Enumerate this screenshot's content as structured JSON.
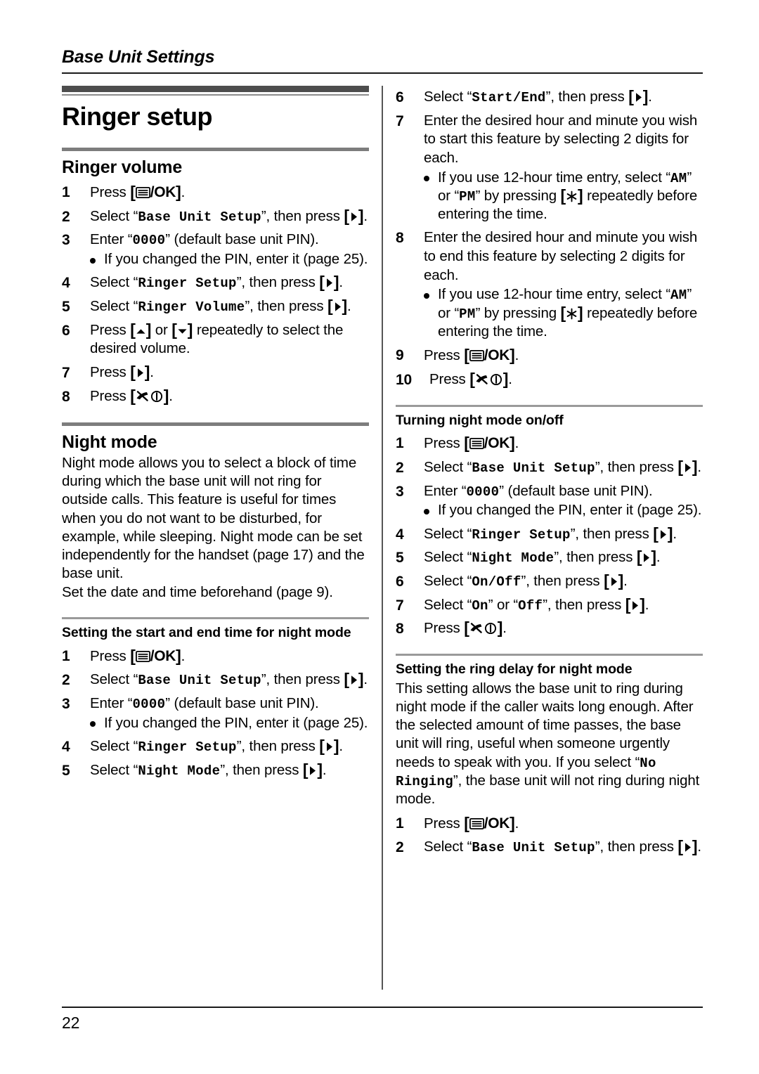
{
  "running_head": "Base Unit Settings",
  "page_number": "22",
  "chapter_title": "Ringer setup",
  "keys": {
    "menu_ok": "[▤/OK]",
    "right": "[▶]",
    "up": "[▲]",
    "down": "[▼]",
    "star": "[✳]",
    "power_off": "[✗ⓘ]"
  },
  "left_column": {
    "section_ringer_volume": {
      "heading": "Ringer volume",
      "steps": [
        {
          "num": "1",
          "parts": [
            {
              "t": "text",
              "v": "Press "
            },
            {
              "t": "key",
              "v": "menu_ok"
            },
            {
              "t": "text",
              "v": "."
            }
          ]
        },
        {
          "num": "2",
          "parts": [
            {
              "t": "text",
              "v": "Select “"
            },
            {
              "t": "mono",
              "v": "Base Unit Setup"
            },
            {
              "t": "text",
              "v": "”, then press "
            },
            {
              "t": "key",
              "v": "right"
            },
            {
              "t": "text",
              "v": "."
            }
          ]
        },
        {
          "num": "3",
          "parts": [
            {
              "t": "text",
              "v": "Enter “"
            },
            {
              "t": "mono",
              "v": "0000"
            },
            {
              "t": "text",
              "v": "” (default base unit PIN)."
            }
          ],
          "bullets": [
            "If you changed the PIN, enter it (page 25)."
          ]
        },
        {
          "num": "4",
          "parts": [
            {
              "t": "text",
              "v": "Select “"
            },
            {
              "t": "mono",
              "v": "Ringer Setup"
            },
            {
              "t": "text",
              "v": "”, then press "
            },
            {
              "t": "key",
              "v": "right"
            },
            {
              "t": "text",
              "v": "."
            }
          ]
        },
        {
          "num": "5",
          "parts": [
            {
              "t": "text",
              "v": "Select “"
            },
            {
              "t": "mono",
              "v": "Ringer Volume"
            },
            {
              "t": "text",
              "v": "”, then press "
            },
            {
              "t": "key",
              "v": "right"
            },
            {
              "t": "text",
              "v": "."
            }
          ]
        },
        {
          "num": "6",
          "parts": [
            {
              "t": "text",
              "v": "Press "
            },
            {
              "t": "key",
              "v": "up"
            },
            {
              "t": "text",
              "v": " or "
            },
            {
              "t": "key",
              "v": "down"
            },
            {
              "t": "text",
              "v": " repeatedly to select the desired volume."
            }
          ]
        },
        {
          "num": "7",
          "parts": [
            {
              "t": "text",
              "v": "Press "
            },
            {
              "t": "key",
              "v": "right"
            },
            {
              "t": "text",
              "v": "."
            }
          ]
        },
        {
          "num": "8",
          "parts": [
            {
              "t": "text",
              "v": "Press "
            },
            {
              "t": "key",
              "v": "power_off"
            },
            {
              "t": "text",
              "v": "."
            }
          ]
        }
      ]
    },
    "section_night_mode": {
      "heading": "Night mode",
      "paragraphs": [
        "Night mode allows you to select a block of time during which the base unit will not ring for outside calls. This feature is useful for times when you do not want to be disturbed, for example, while sleeping. Night mode can be set independently for the handset (page 17) and the base unit.",
        "Set the date and time beforehand (page 9)."
      ],
      "subsection_start_end": {
        "heading": "Setting the start and end time for night mode",
        "steps": [
          {
            "num": "1",
            "parts": [
              {
                "t": "text",
                "v": "Press "
              },
              {
                "t": "key",
                "v": "menu_ok"
              },
              {
                "t": "text",
                "v": "."
              }
            ]
          },
          {
            "num": "2",
            "parts": [
              {
                "t": "text",
                "v": "Select “"
              },
              {
                "t": "mono",
                "v": "Base Unit Setup"
              },
              {
                "t": "text",
                "v": "”, then press "
              },
              {
                "t": "key",
                "v": "right"
              },
              {
                "t": "text",
                "v": "."
              }
            ]
          },
          {
            "num": "3",
            "parts": [
              {
                "t": "text",
                "v": "Enter “"
              },
              {
                "t": "mono",
                "v": "0000"
              },
              {
                "t": "text",
                "v": "” (default base unit PIN)."
              }
            ],
            "bullets": [
              "If you changed the PIN, enter it (page 25)."
            ]
          },
          {
            "num": "4",
            "parts": [
              {
                "t": "text",
                "v": "Select “"
              },
              {
                "t": "mono",
                "v": "Ringer Setup"
              },
              {
                "t": "text",
                "v": "”, then press "
              },
              {
                "t": "key",
                "v": "right"
              },
              {
                "t": "text",
                "v": "."
              }
            ]
          },
          {
            "num": "5",
            "parts": [
              {
                "t": "text",
                "v": "Select “"
              },
              {
                "t": "mono",
                "v": "Night Mode"
              },
              {
                "t": "text",
                "v": "”, then press "
              },
              {
                "t": "key",
                "v": "right"
              },
              {
                "t": "text",
                "v": "."
              }
            ]
          }
        ]
      }
    }
  },
  "right_column": {
    "continued_start_end_steps": [
      {
        "num": "6",
        "parts": [
          {
            "t": "text",
            "v": "Select “"
          },
          {
            "t": "mono",
            "v": "Start/End"
          },
          {
            "t": "text",
            "v": "”, then press "
          },
          {
            "t": "key",
            "v": "right"
          },
          {
            "t": "text",
            "v": "."
          }
        ]
      },
      {
        "num": "7",
        "parts": [
          {
            "t": "text",
            "v": "Enter the desired hour and minute you wish to start this feature by selecting 2 digits for each."
          }
        ],
        "bullet_parts": [
          [
            {
              "t": "text",
              "v": "If you use 12-hour time entry, select “"
            },
            {
              "t": "mono",
              "v": "AM"
            },
            {
              "t": "text",
              "v": "” or “"
            },
            {
              "t": "mono",
              "v": "PM"
            },
            {
              "t": "text",
              "v": "” by pressing "
            },
            {
              "t": "key",
              "v": "star"
            },
            {
              "t": "text",
              "v": " repeatedly before entering the time."
            }
          ]
        ]
      },
      {
        "num": "8",
        "parts": [
          {
            "t": "text",
            "v": "Enter the desired hour and minute you wish to end this feature by selecting 2 digits for each."
          }
        ],
        "bullet_parts": [
          [
            {
              "t": "text",
              "v": "If you use 12-hour time entry, select “"
            },
            {
              "t": "mono",
              "v": "AM"
            },
            {
              "t": "text",
              "v": "” or “"
            },
            {
              "t": "mono",
              "v": "PM"
            },
            {
              "t": "text",
              "v": "” by pressing "
            },
            {
              "t": "key",
              "v": "star"
            },
            {
              "t": "text",
              "v": " repeatedly before entering the time."
            }
          ]
        ]
      },
      {
        "num": "9",
        "parts": [
          {
            "t": "text",
            "v": "Press "
          },
          {
            "t": "key",
            "v": "menu_ok"
          },
          {
            "t": "text",
            "v": "."
          }
        ]
      },
      {
        "num": "10",
        "wide": true,
        "parts": [
          {
            "t": "text",
            "v": "Press "
          },
          {
            "t": "key",
            "v": "power_off"
          },
          {
            "t": "text",
            "v": "."
          }
        ]
      }
    ],
    "subsection_on_off": {
      "heading": "Turning night mode on/off",
      "steps": [
        {
          "num": "1",
          "parts": [
            {
              "t": "text",
              "v": "Press "
            },
            {
              "t": "key",
              "v": "menu_ok"
            },
            {
              "t": "text",
              "v": "."
            }
          ]
        },
        {
          "num": "2",
          "parts": [
            {
              "t": "text",
              "v": "Select “"
            },
            {
              "t": "mono",
              "v": "Base Unit Setup"
            },
            {
              "t": "text",
              "v": "”, then press "
            },
            {
              "t": "key",
              "v": "right"
            },
            {
              "t": "text",
              "v": "."
            }
          ]
        },
        {
          "num": "3",
          "parts": [
            {
              "t": "text",
              "v": "Enter “"
            },
            {
              "t": "mono",
              "v": "0000"
            },
            {
              "t": "text",
              "v": "” (default base unit PIN)."
            }
          ],
          "bullets": [
            "If you changed the PIN, enter it (page 25)."
          ]
        },
        {
          "num": "4",
          "parts": [
            {
              "t": "text",
              "v": "Select “"
            },
            {
              "t": "mono",
              "v": "Ringer Setup"
            },
            {
              "t": "text",
              "v": "”, then press "
            },
            {
              "t": "key",
              "v": "right"
            },
            {
              "t": "text",
              "v": "."
            }
          ]
        },
        {
          "num": "5",
          "parts": [
            {
              "t": "text",
              "v": "Select “"
            },
            {
              "t": "mono",
              "v": "Night Mode"
            },
            {
              "t": "text",
              "v": "”, then press "
            },
            {
              "t": "key",
              "v": "right"
            },
            {
              "t": "text",
              "v": "."
            }
          ]
        },
        {
          "num": "6",
          "parts": [
            {
              "t": "text",
              "v": "Select “"
            },
            {
              "t": "mono",
              "v": "On/Off"
            },
            {
              "t": "text",
              "v": "”, then press "
            },
            {
              "t": "key",
              "v": "right"
            },
            {
              "t": "text",
              "v": "."
            }
          ]
        },
        {
          "num": "7",
          "parts": [
            {
              "t": "text",
              "v": "Select “"
            },
            {
              "t": "mono",
              "v": "On"
            },
            {
              "t": "text",
              "v": "” or “"
            },
            {
              "t": "mono",
              "v": "Off"
            },
            {
              "t": "text",
              "v": "”, then press "
            },
            {
              "t": "key",
              "v": "right"
            },
            {
              "t": "text",
              "v": "."
            }
          ]
        },
        {
          "num": "8",
          "parts": [
            {
              "t": "text",
              "v": "Press "
            },
            {
              "t": "key",
              "v": "power_off"
            },
            {
              "t": "text",
              "v": "."
            }
          ]
        }
      ]
    },
    "subsection_ring_delay": {
      "heading": "Setting the ring delay for night mode",
      "intro_parts": [
        {
          "t": "text",
          "v": "This setting allows the base unit to ring during night mode if the caller waits long enough. After the selected amount of time passes, the base unit will ring, useful when someone urgently needs to speak with you. If you select “"
        },
        {
          "t": "mono",
          "v": "No Ringing"
        },
        {
          "t": "text",
          "v": "”, the base unit will not ring during night mode."
        }
      ],
      "steps": [
        {
          "num": "1",
          "parts": [
            {
              "t": "text",
              "v": "Press "
            },
            {
              "t": "key",
              "v": "menu_ok"
            },
            {
              "t": "text",
              "v": "."
            }
          ]
        },
        {
          "num": "2",
          "parts": [
            {
              "t": "text",
              "v": "Select “"
            },
            {
              "t": "mono",
              "v": "Base Unit Setup"
            },
            {
              "t": "text",
              "v": "”, then press "
            },
            {
              "t": "key",
              "v": "right"
            },
            {
              "t": "text",
              "v": "."
            }
          ]
        }
      ]
    }
  }
}
